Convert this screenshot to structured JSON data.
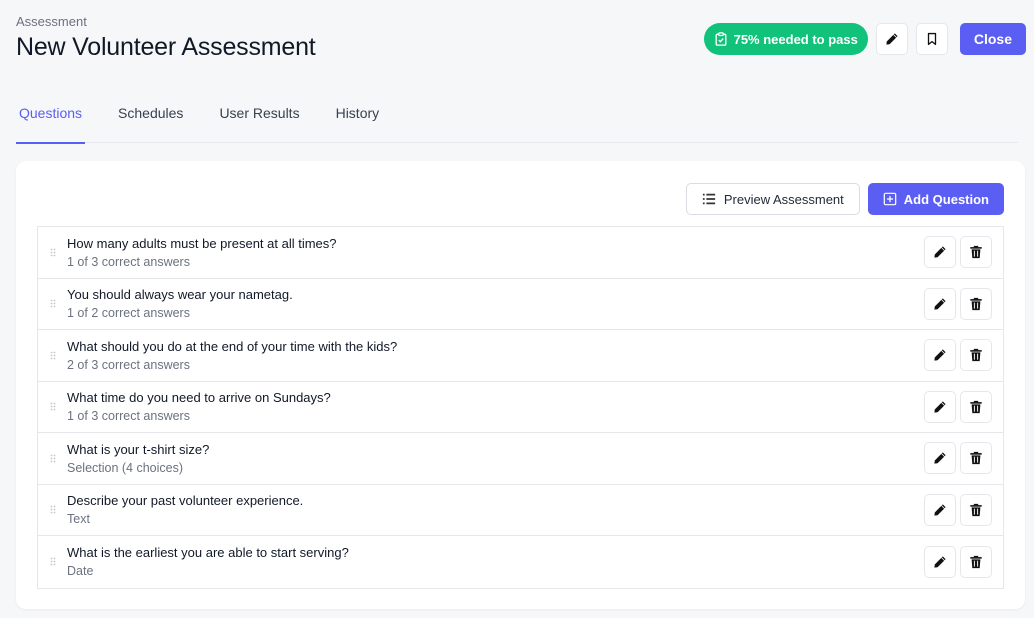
{
  "header": {
    "eyebrow": "Assessment",
    "title": "New Volunteer Assessment",
    "pass_badge": "75% needed to pass",
    "close_label": "Close"
  },
  "tabs": [
    {
      "label": "Questions",
      "active": true
    },
    {
      "label": "Schedules",
      "active": false
    },
    {
      "label": "User Results",
      "active": false
    },
    {
      "label": "History",
      "active": false
    }
  ],
  "actions": {
    "preview_label": "Preview Assessment",
    "add_label": "Add Question"
  },
  "questions": [
    {
      "title": "How many adults must be present at all times?",
      "subtitle": "1 of 3 correct answers"
    },
    {
      "title": "You should always wear your nametag.",
      "subtitle": "1 of 2 correct answers"
    },
    {
      "title": "What should you do at the end of your time with the kids?",
      "subtitle": "2 of 3 correct answers"
    },
    {
      "title": "What time do you need to arrive on Sundays?",
      "subtitle": "1 of 3 correct answers"
    },
    {
      "title": "What is your t-shirt size?",
      "subtitle": "Selection (4 choices)"
    },
    {
      "title": "Describe your past volunteer experience.",
      "subtitle": "Text"
    },
    {
      "title": "What is the earliest you are able to start serving?",
      "subtitle": "Date"
    }
  ],
  "colors": {
    "accent": "#5b5ef3",
    "success": "#10c27a"
  },
  "icons": {
    "badge": "clipboard-check-icon",
    "edit": "pencil-icon",
    "bookmark": "bookmark-icon",
    "preview": "list-icon",
    "add": "plus-square-icon",
    "delete": "trash-icon",
    "drag": "drag-handle-icon"
  }
}
